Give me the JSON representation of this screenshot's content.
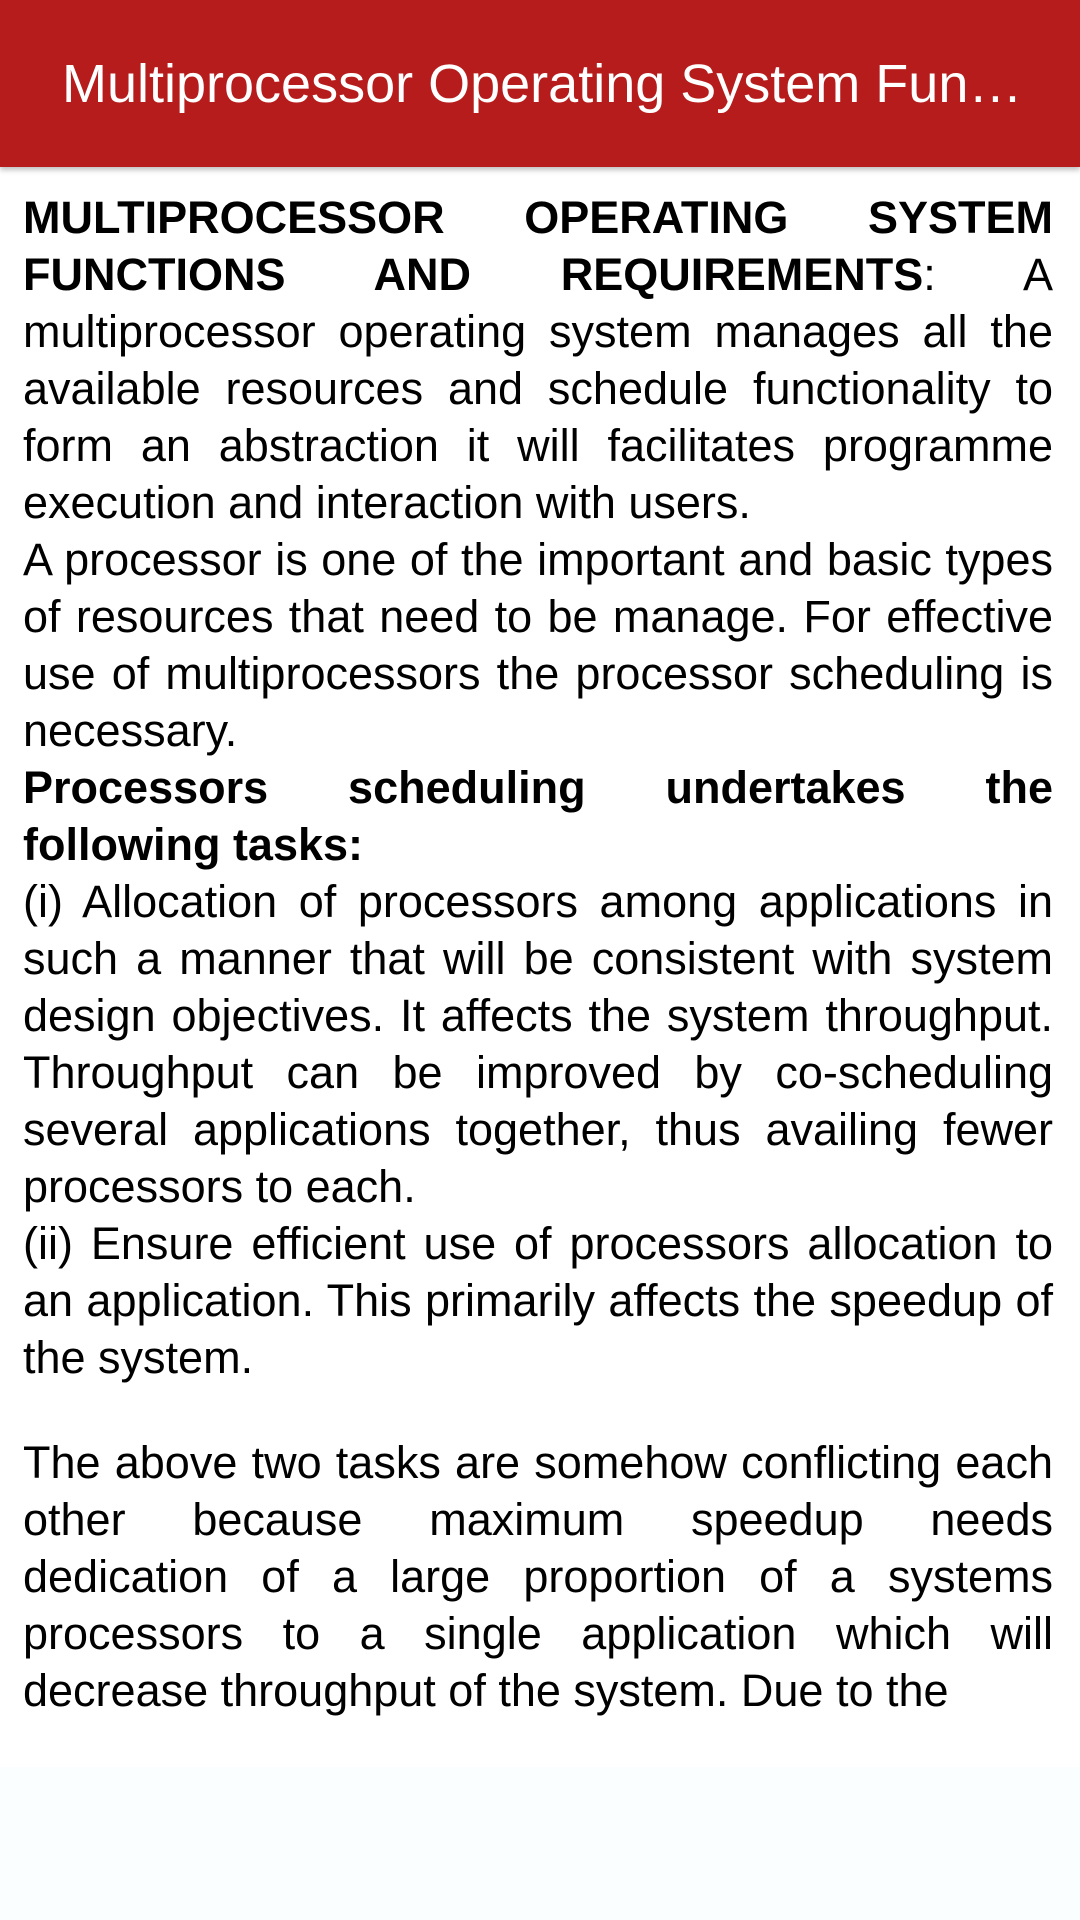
{
  "app_bar": {
    "title": "Multiprocessor Operating System Functions and Requirements",
    "background_color": "#b71c1c",
    "title_color": "#ffffff"
  },
  "article": {
    "intro_heading": "MULTIPROCESSOR OPERATING SYSTEM FUNCTIONS AND REQUIREMENTS",
    "intro_colon": ":",
    "intro_body": " A multiprocessor operating system manages all the available resources and schedule functionality to form an abstraction it will facilitates programme execution and interaction with users.",
    "para2": "A processor is one of the important and basic types of resources that need to be manage. For effective use of multiprocessors the processor scheduling is necessary.",
    "tasks_heading": "Processors scheduling undertakes the following tasks:",
    "task1": "(i) Allocation of processors among applications in such a manner that will be consistent with system design objectives. It affects the system throughput. Throughput can be improved by co-scheduling several applications together, thus availing fewer processors to each.",
    "task2": "(ii) Ensure efficient use of processors allocation to an application. This primarily affects the speedup of the system.",
    "para3": "The above two tasks are somehow conflicting each other because maximum speedup needs dedication of a large proportion of a systems processors to a single application which will decrease throughput of the system. Due to the"
  }
}
